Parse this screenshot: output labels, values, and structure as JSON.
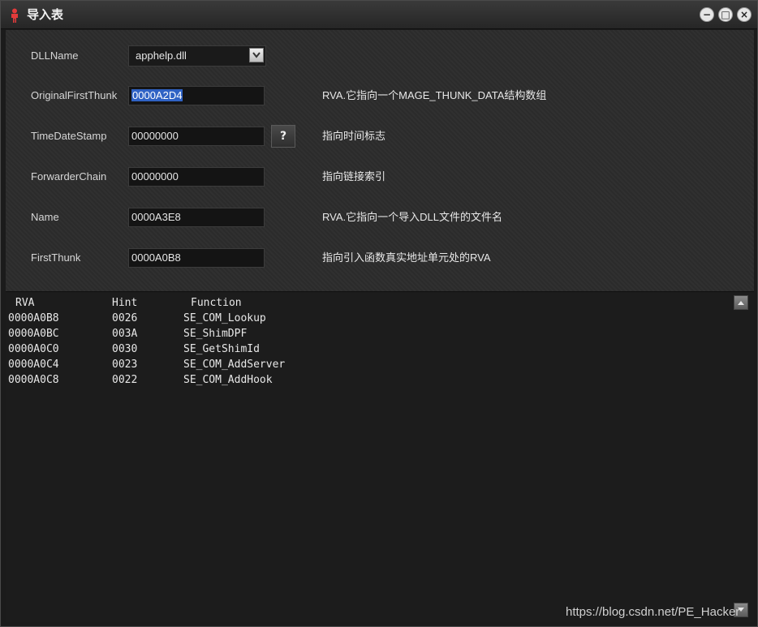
{
  "window": {
    "title": "导入表",
    "controls": {
      "minimize": "−",
      "maximize": "□",
      "close": "×"
    }
  },
  "form": {
    "dllname": {
      "label": "DLLName",
      "value": "apphelp.dll"
    },
    "original_first_thunk": {
      "label": "OriginalFirstThunk",
      "value": "0000A2D4",
      "desc": "RVA.它指向一个MAGE_THUNK_DATA结构数组"
    },
    "time_date_stamp": {
      "label": "TimeDateStamp",
      "value": "00000000",
      "help": "?",
      "desc": "指向时间标志"
    },
    "forwarder_chain": {
      "label": "ForwarderChain",
      "value": "00000000",
      "desc": "指向链接索引"
    },
    "name": {
      "label": "Name",
      "value": "0000A3E8",
      "desc": "RVA.它指向一个导入DLL文件的文件名"
    },
    "first_thunk": {
      "label": "FirstThunk",
      "value": "0000A0B8",
      "desc": "指向引入函数真实地址单元处的RVA"
    }
  },
  "list": {
    "headers": [
      "RVA",
      "Hint",
      "Function"
    ],
    "rows": [
      [
        "0000A0B8",
        "0026",
        "SE_COM_Lookup"
      ],
      [
        "0000A0BC",
        "003A",
        "SE_ShimDPF"
      ],
      [
        "0000A0C0",
        "0030",
        "SE_GetShimId"
      ],
      [
        "0000A0C4",
        "0023",
        "SE_COM_AddServer"
      ],
      [
        "0000A0C8",
        "0022",
        "SE_COM_AddHook"
      ]
    ]
  },
  "watermark": "https://blog.csdn.net/PE_Hacker"
}
